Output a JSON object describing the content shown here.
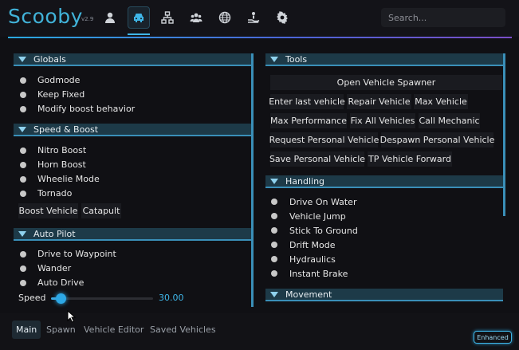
{
  "app": {
    "title": "Scooby",
    "version": "v2.9"
  },
  "search": {
    "placeholder": "Search..."
  },
  "nav_icons": [
    "user-icon",
    "car-icon",
    "network-icon",
    "group-icon",
    "globe-icon",
    "hand-icon",
    "gear-icon"
  ],
  "globals": {
    "header": "Globals",
    "items": [
      "Godmode",
      "Keep Fixed",
      "Modify boost behavior"
    ]
  },
  "speed_boost": {
    "header": "Speed & Boost",
    "items": [
      "Nitro Boost",
      "Horn Boost",
      "Wheelie Mode",
      "Tornado"
    ],
    "buttons": [
      "Boost Vehicle",
      "Catapult"
    ]
  },
  "auto_pilot": {
    "header": "Auto Pilot",
    "items": [
      "Drive to Waypoint",
      "Wander",
      "Auto Drive"
    ],
    "speed_label": "Speed",
    "speed_value": "30.00",
    "speed_fraction": 0.09
  },
  "tools": {
    "header": "Tools",
    "buttons": [
      "Open Vehicle Spawner",
      "Enter last vehicle",
      "Repair Vehicle",
      "Max Vehicle",
      "Max Performance",
      "Fix All Vehicles",
      "Call Mechanic",
      "Request Personal Vehicle",
      "Despawn Personal Vehicle",
      "Save Personal Vehicle",
      "TP Vehicle Forward"
    ]
  },
  "handling": {
    "header": "Handling",
    "items": [
      "Drive On Water",
      "Vehicle Jump",
      "Stick To Ground",
      "Drift Mode",
      "Hydraulics",
      "Instant Brake"
    ]
  },
  "movement": {
    "header": "Movement"
  },
  "tabs": [
    "Main",
    "Spawn",
    "Vehicle Editor",
    "Saved Vehicles"
  ],
  "badge": "Enhanced",
  "colors": {
    "accent": "#3fb6e8",
    "section_header": "#1d3a48",
    "background": "#101014"
  }
}
